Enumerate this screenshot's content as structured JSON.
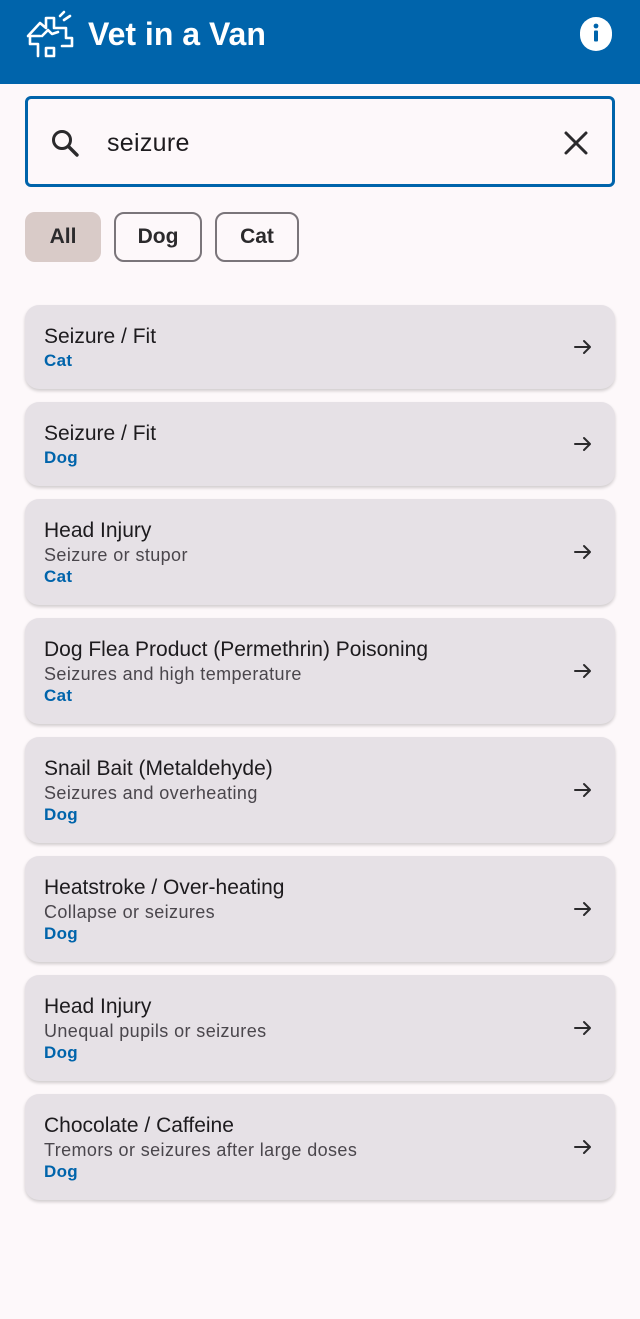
{
  "app": {
    "title": "Vet in a Van",
    "logo_icon": "vet-van-logo-icon",
    "info_icon": "info-icon",
    "primary_color": "#0064ab"
  },
  "search": {
    "value": "seizure",
    "search_icon": "search-icon",
    "clear_icon": "close-icon"
  },
  "filters": {
    "selected": "All",
    "chips": [
      {
        "label": "All"
      },
      {
        "label": "Dog"
      },
      {
        "label": "Cat"
      }
    ]
  },
  "results": [
    {
      "title": "Seizure / Fit",
      "subtitle": "",
      "species": "Cat"
    },
    {
      "title": "Seizure / Fit",
      "subtitle": "",
      "species": "Dog"
    },
    {
      "title": "Head Injury",
      "subtitle": "Seizure or stupor",
      "species": "Cat"
    },
    {
      "title": "Dog Flea Product (Permethrin) Poisoning",
      "subtitle": "Seizures and high temperature",
      "species": "Cat"
    },
    {
      "title": "Snail Bait (Metaldehyde)",
      "subtitle": "Seizures and overheating",
      "species": "Dog"
    },
    {
      "title": "Heatstroke / Over-heating",
      "subtitle": "Collapse or seizures",
      "species": "Dog"
    },
    {
      "title": "Head Injury",
      "subtitle": "Unequal pupils or seizures",
      "species": "Dog"
    },
    {
      "title": "Chocolate / Caffeine",
      "subtitle": "Tremors or seizures after large doses",
      "species": "Dog"
    }
  ]
}
